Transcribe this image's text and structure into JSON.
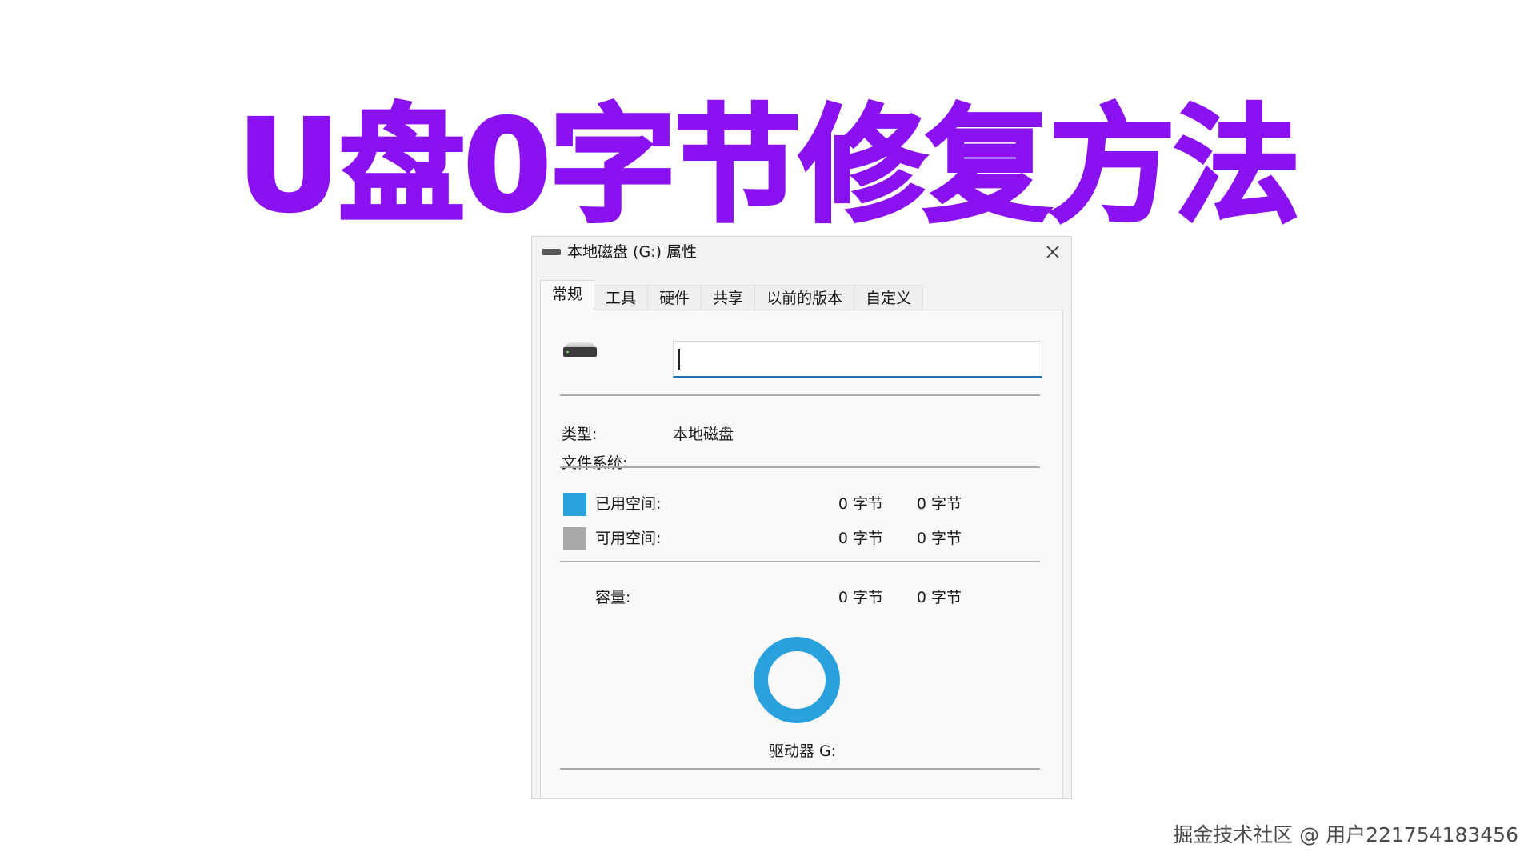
{
  "headline": "U盘0字节修复方法",
  "colors": {
    "headline": "#8a12f0",
    "used_space": "#2aa0dc",
    "free_space": "#a9a9a9",
    "donut": "#2aa0dc",
    "input_underline": "#1f6fb6"
  },
  "window": {
    "title": "本地磁盘 (G:) 属性",
    "title_icon": "drive-icon",
    "close_icon": "close-icon"
  },
  "tabs": [
    {
      "label": "常规",
      "active": true
    },
    {
      "label": "工具",
      "active": false
    },
    {
      "label": "硬件",
      "active": false
    },
    {
      "label": "共享",
      "active": false
    },
    {
      "label": "以前的版本",
      "active": false
    },
    {
      "label": "自定义",
      "active": false
    }
  ],
  "general": {
    "drive_icon": "hard-drive-icon",
    "name_input_value": "",
    "type_label": "类型:",
    "type_value": "本地磁盘",
    "filesystem_label": "文件系统:",
    "filesystem_value": "",
    "used_label": "已用空间:",
    "used_bytes": "0 字节",
    "used_size": "0 字节",
    "free_label": "可用空间:",
    "free_bytes": "0 字节",
    "free_size": "0 字节",
    "capacity_label": "容量:",
    "capacity_bytes": "0 字节",
    "capacity_size": "0 字节",
    "drive_label": "驱动器 G:"
  },
  "watermark": "掘金技术社区 @ 用户221754183456"
}
